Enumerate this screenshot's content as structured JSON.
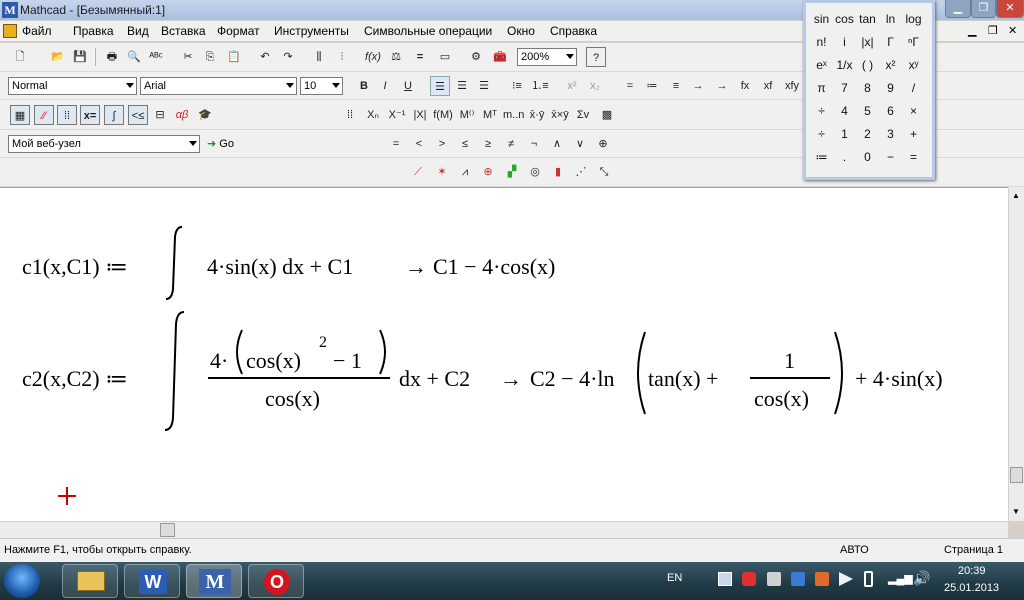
{
  "window": {
    "title": "Mathcad - [Безымянный:1]"
  },
  "menu": [
    "Файл",
    "Правка",
    "Вид",
    "Вставка",
    "Формат",
    "Инструменты",
    "Символьные операции",
    "Окно",
    "Справка"
  ],
  "toolbar": {
    "zoom": "200%"
  },
  "format_bar": {
    "style": "Normal",
    "font": "Arial",
    "size": "10",
    "bold": "B",
    "italic": "I",
    "underline": "U"
  },
  "resources_bar": {
    "site": "Мой веб-узел",
    "go": "Go"
  },
  "evaluation_bar": [
    "=",
    "<",
    ">",
    "≤",
    "≥",
    "≠",
    "¬",
    "∧",
    "∨",
    "⊕"
  ],
  "symbolic_row": [
    "=",
    "≔",
    "≡",
    "→",
    "→",
    "fx",
    "xf",
    "xfy"
  ],
  "palette": {
    "rows": [
      [
        "sin",
        "cos",
        "tan",
        "ln",
        "log"
      ],
      [
        "n!",
        "i",
        "|x|",
        "Γ",
        "ⁿΓ"
      ],
      [
        "eˣ",
        "1/x",
        "( )",
        "x²",
        "xʸ"
      ],
      [
        "π",
        "7",
        "8",
        "9",
        "/"
      ],
      [
        "÷",
        "4",
        "5",
        "6",
        "×"
      ],
      [
        "÷",
        "1",
        "2",
        "3",
        "+"
      ],
      [
        "≔",
        ".",
        "0",
        "−",
        "="
      ]
    ]
  },
  "equations": {
    "eq1": {
      "lhs": "c1(x,C1) ≔",
      "integrand": "4·sin(x) dx + C1",
      "arrow": "→",
      "result": "C1 − 4·cos(x)"
    },
    "eq2": {
      "lhs": "c2(x,C2) ≔",
      "num_a": "4·",
      "num_b": "cos(x)",
      "num_exp": "2",
      "num_c": " − 1",
      "den": "cos(x)",
      "tail": "dx + C2",
      "arrow": "→",
      "res_a": "C2 − 4·ln",
      "res_b": "tan(x) +",
      "frac_num": "1",
      "frac_den": "cos(x)",
      "res_c": "+ 4·sin(x)"
    }
  },
  "status": {
    "help": "Нажмите F1, чтобы открыть справку.",
    "mode": "АВТО",
    "page": "Страница 1"
  },
  "taskbar": {
    "lang": "EN",
    "time": "20:39",
    "date": "25.01.2013"
  },
  "colors": {
    "cursor": "#cc0000",
    "title_bg": "#b9cbe6"
  }
}
